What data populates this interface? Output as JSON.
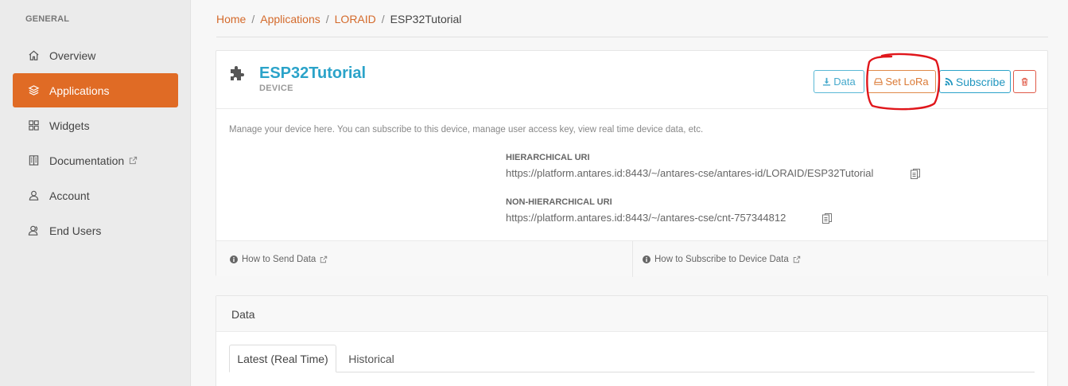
{
  "sidebar": {
    "heading": "GENERAL",
    "items": [
      {
        "label": "Overview",
        "icon": "home-icon"
      },
      {
        "label": "Applications",
        "icon": "layers-icon",
        "active": true
      },
      {
        "label": "Widgets",
        "icon": "grid-icon"
      },
      {
        "label": "Documentation",
        "icon": "book-icon",
        "external": true
      },
      {
        "label": "Account",
        "icon": "user-icon"
      },
      {
        "label": "End Users",
        "icon": "users-icon"
      }
    ]
  },
  "breadcrumb": {
    "home": "Home",
    "applications": "Applications",
    "app": "LORAID",
    "current": "ESP32Tutorial",
    "separator": "/"
  },
  "device": {
    "title": "ESP32Tutorial",
    "subtitle": "DEVICE",
    "description": "Manage your device here. You can subscribe to this device, manage user access key, view real time device data, etc.",
    "hierarchical_label": "HIERARCHICAL URI",
    "hierarchical_uri": "https://platform.antares.id:8443/~/antares-cse/antares-id/LORAID/ESP32Tutorial",
    "non_hierarchical_label": "NON-HIERARCHICAL URI",
    "non_hierarchical_uri": "https://platform.antares.id:8443/~/antares-cse/cnt-757344812"
  },
  "buttons": {
    "data": "Data",
    "set_lora": "Set LoRa",
    "subscribe": "Subscribe"
  },
  "footer": {
    "send_data": "How to Send Data",
    "subscribe_data": "How to Subscribe to Device Data"
  },
  "data_panel": {
    "title": "Data",
    "tab_latest": "Latest (Real Time)",
    "tab_historical": "Historical"
  },
  "colors": {
    "accent": "#e06b25",
    "link": "#d46a2b",
    "title_blue": "#2ba3c9",
    "annotation_red": "#e0161b"
  }
}
